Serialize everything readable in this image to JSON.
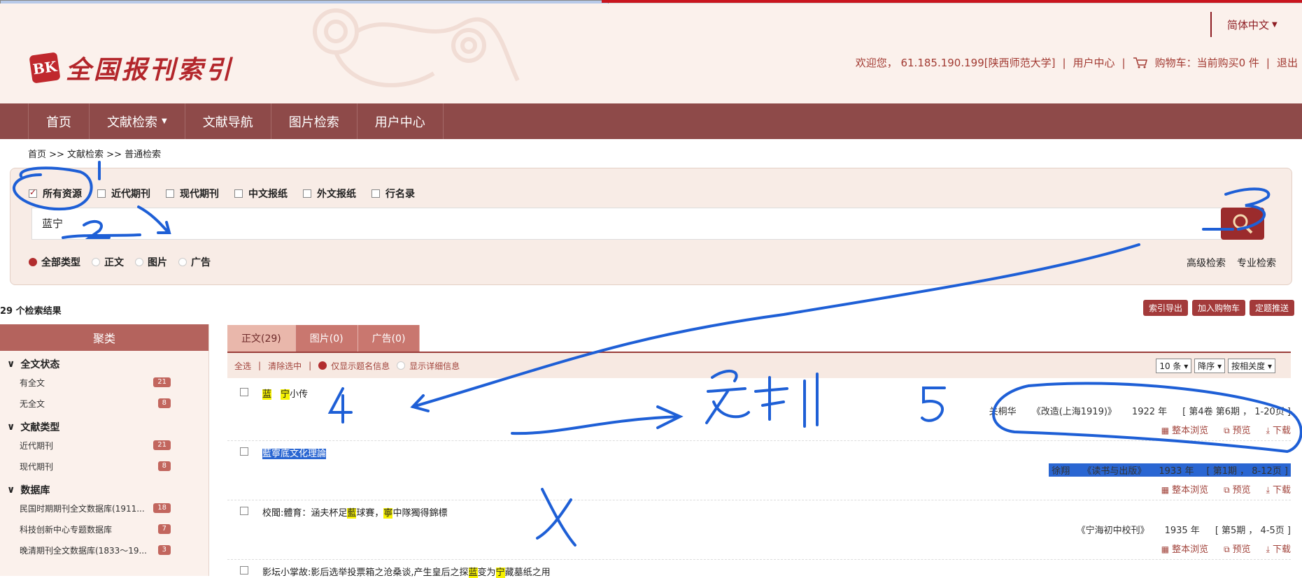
{
  "header": {
    "logo_seal": "BK",
    "logo_text": "全国报刊索引",
    "language": "简体中文",
    "welcome": "欢迎您，  61.185.190.199[陕西师范大学]",
    "user_center": "用户中心",
    "cart": "购物车：当前购买0 件",
    "logout": "退出"
  },
  "nav": {
    "items": [
      "首页",
      "文献检索",
      "文献导航",
      "图片检索",
      "用户中心"
    ]
  },
  "breadcrumb": "首页 >> 文献检索 >> 普通检索",
  "search": {
    "sources": [
      "所有资源",
      "近代期刊",
      "现代期刊",
      "中文报纸",
      "外文报纸",
      "行名录"
    ],
    "query": "蓝宁",
    "types": [
      "全部类型",
      "正文",
      "图片",
      "广告"
    ],
    "advanced": "高级检索",
    "expert": "专业检索"
  },
  "results_count": "29 个检索结果",
  "actions": [
    "索引导出",
    "加入购物车",
    "定题推送"
  ],
  "sidebar": {
    "title": "聚类",
    "groups": [
      {
        "name": "全文状态",
        "items": [
          {
            "label": "有全文",
            "count": "21"
          },
          {
            "label": "无全文",
            "count": "8"
          }
        ]
      },
      {
        "name": "文献类型",
        "items": [
          {
            "label": "近代期刊",
            "count": "21"
          },
          {
            "label": "现代期刊",
            "count": "8"
          }
        ]
      },
      {
        "name": "数据库",
        "items": [
          {
            "label": "民国时期期刊全文数据库(1911...",
            "count": "18"
          },
          {
            "label": "科技创新中心专题数据库",
            "count": "7"
          },
          {
            "label": "晚清期刊全文数据库(1833～19...",
            "count": "3"
          }
        ]
      }
    ]
  },
  "tabs": [
    "正文(29)",
    "图片(0)",
    "广告(0)"
  ],
  "toolbar": {
    "select_all": "全选",
    "clear": "清除选中",
    "title_only": "仅显示题名信息",
    "detail": "显示详细信息",
    "per_page": "10 条",
    "order": "降序",
    "sort": "按相关度"
  },
  "results": [
    {
      "title_parts": [
        [
          "hl",
          "蓝"
        ],
        [
          "",
          "　"
        ],
        [
          "hl",
          "宁"
        ],
        [
          "",
          "小传"
        ]
      ],
      "author": "关桐华",
      "journal": "《改造(上海1919)》",
      "year": "1922 年",
      "issue": "[ 第4卷 第6期 ，  1-20页 ]"
    },
    {
      "title_parts": [
        [
          "selhl",
          "藍"
        ],
        [
          "selhl",
          "寧"
        ],
        [
          "selhl",
          "底文化理論"
        ]
      ],
      "author": "徐翔",
      "journal": "《读书与出版》",
      "year": "1933 年",
      "issue": "[ 第1期 ，  8-12页 ]"
    },
    {
      "title_parts": [
        [
          "",
          "校聞:體育：涵夫杯足"
        ],
        [
          "hl",
          "藍"
        ],
        [
          "",
          "球賽，"
        ],
        [
          "hl",
          "寧"
        ],
        [
          "",
          "中隊獨得錦標"
        ]
      ],
      "author": "",
      "journal": "《宁海初中校刊》",
      "year": "1935 年",
      "issue": "[ 第5期 ，  4-5页 ]"
    },
    {
      "title_parts": [
        [
          "",
          "影坛小掌故:影后选举投票箱之沧桑谈,产生皇后之探"
        ],
        [
          "hl",
          "蓝"
        ],
        [
          "",
          "变为"
        ],
        [
          "hl",
          "宁"
        ],
        [
          "",
          "藏墓纸之用"
        ]
      ],
      "author": "",
      "journal": "",
      "year": "",
      "issue": ""
    }
  ],
  "result_actions": [
    "整本浏览",
    "预览",
    "下载"
  ],
  "annotations": [
    "2",
    "3",
    "4",
    "5",
    "复制"
  ],
  "colors": {
    "brand": "#8e4a49",
    "accent": "#b3262b",
    "annotation": "#1e5fd6"
  }
}
